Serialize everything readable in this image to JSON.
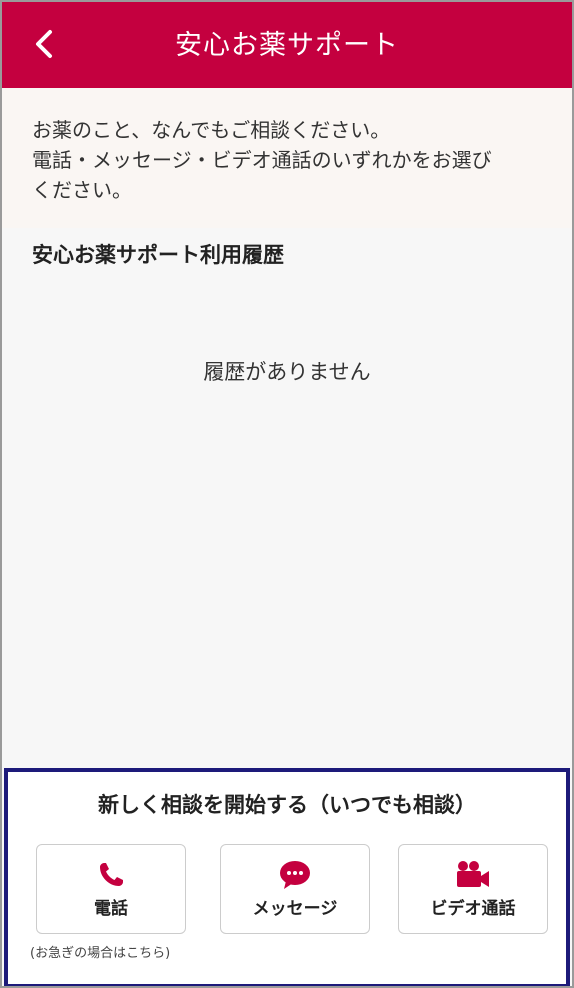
{
  "header": {
    "title": "安心お薬サポート",
    "back_icon": "chevron-left-icon",
    "color": "#c4003f"
  },
  "intro": {
    "line1": "お薬のこと、なんでもご相談ください。",
    "line2": "電話・メッセージ・ビデオ通話のいずれかをお選び",
    "line3": "ください。"
  },
  "history": {
    "title": "安心お薬サポート利用履歴",
    "empty_message": "履歴がありません"
  },
  "consult": {
    "title": "新しく相談を開始する（いつでも相談）",
    "buttons": [
      {
        "label": "電話",
        "icon": "phone-icon"
      },
      {
        "label": "メッセージ",
        "icon": "message-icon"
      },
      {
        "label": "ビデオ通話",
        "icon": "video-camera-icon"
      }
    ],
    "note": "(お急ぎの場合はこちら)"
  },
  "colors": {
    "accent": "#c4003f",
    "highlight_border": "#1d1a7a"
  }
}
